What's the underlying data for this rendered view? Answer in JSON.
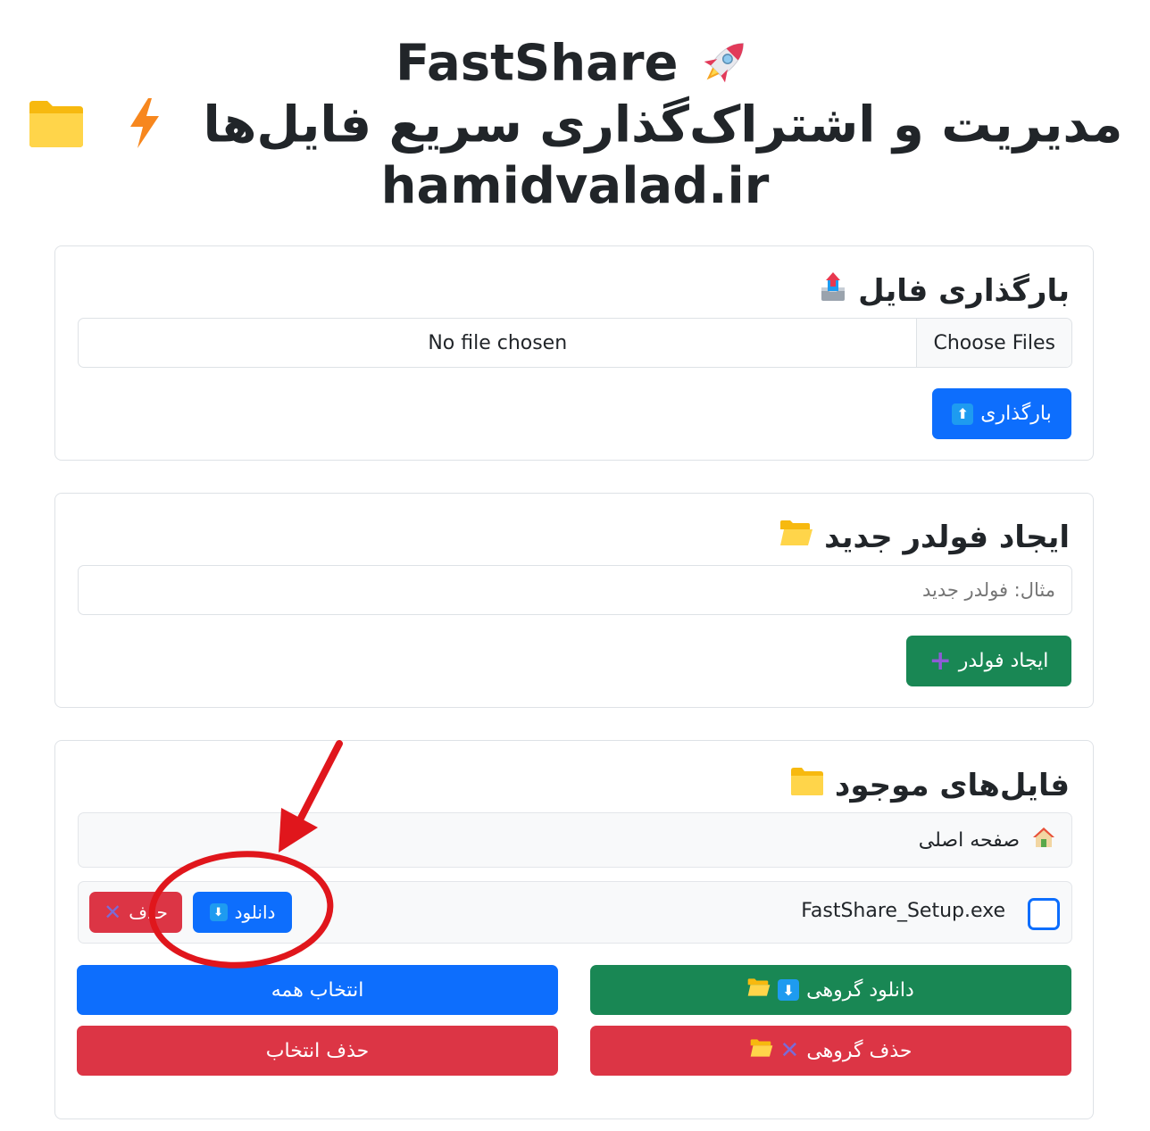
{
  "header": {
    "app_name": "FastShare",
    "subtitle": "مدیریت و اشتراک‌گذاری سریع فایل‌ها",
    "site": "hamidvalad.ir"
  },
  "upload": {
    "title": "بارگذاری فایل",
    "choose_label": "Choose Files",
    "no_file_label": "No file chosen",
    "button_label": "بارگذاری"
  },
  "folder": {
    "title": "ایجاد فولدر جدید",
    "placeholder": "مثال: فولدر جدید",
    "button_label": "ایجاد فولدر"
  },
  "files": {
    "title": "فایل‌های موجود",
    "breadcrumb_home": "صفحه اصلی",
    "items": [
      {
        "name": "FastShare_Setup.exe",
        "checked": false,
        "download_label": "دانلود",
        "delete_label": "حذف"
      }
    ],
    "bulk_download_label": "دانلود گروهی",
    "select_all_label": "انتخاب همه",
    "bulk_delete_label": "حذف گروهی",
    "delete_selection_label": "حذف انتخاب"
  },
  "colors": {
    "primary": "#0d6efd",
    "success": "#198754",
    "danger": "#dc3545",
    "annotation": "#e0161c"
  },
  "icons": [
    "rocket-icon",
    "folder-icon",
    "lightning-icon",
    "outbox-tray-icon",
    "up-arrow-icon",
    "open-folder-icon",
    "plus-icon",
    "house-icon",
    "down-arrow-icon",
    "cross-mark-icon"
  ]
}
